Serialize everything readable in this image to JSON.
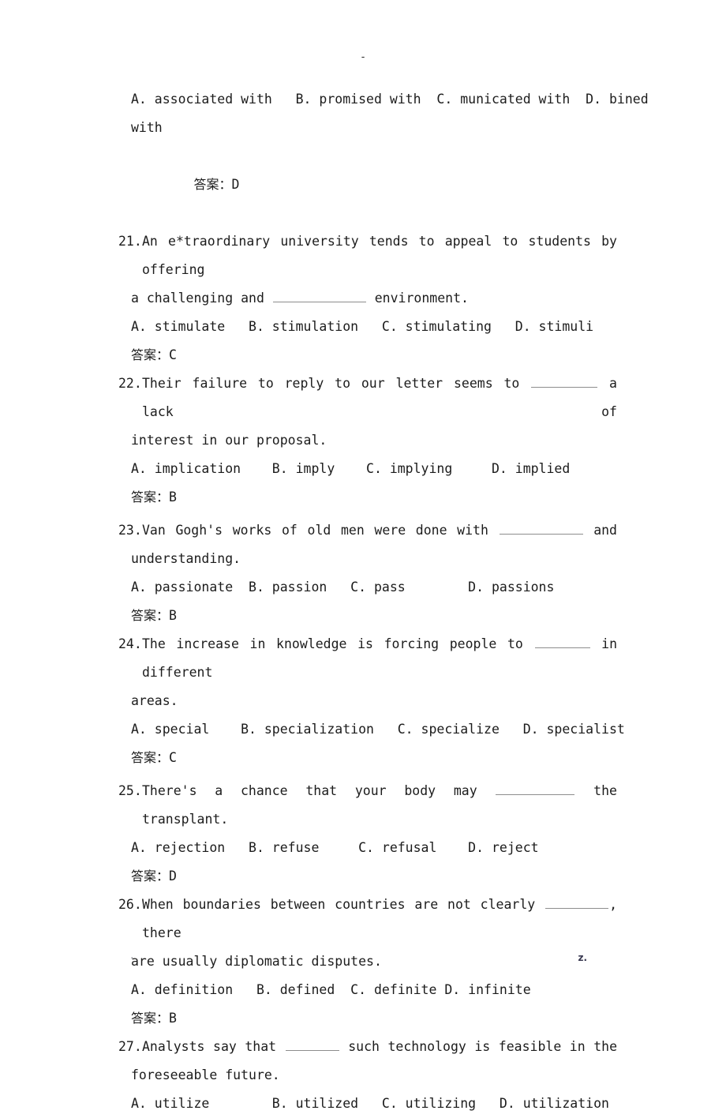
{
  "page": {
    "header_mark": "-",
    "footer_left_mark": "·",
    "footer_right_mark": "z."
  },
  "answer_label": "答案：",
  "partial_question": {
    "options_line": "A. associated with   B. promised with  C. municated with  D. bined",
    "options_wrap": "with",
    "answer": "D"
  },
  "questions": [
    {
      "number": "21.",
      "stem_lines": [
        {
          "pre": "An e*traordinary university tends to appeal to students by offering",
          "blank": 0,
          "post": ""
        },
        {
          "pre": "a challenging and ",
          "blank": 118,
          "post": " environment."
        }
      ],
      "options": "A. stimulate   B. stimulation   C. stimulating   D. stimuli",
      "answer": "C"
    },
    {
      "number": "22.",
      "stem_lines": [
        {
          "pre": "Their failure to reply to our letter seems to ",
          "blank": 84,
          "post": " a lack of"
        },
        {
          "pre": "interest in our proposal.",
          "blank": 0,
          "post": ""
        }
      ],
      "options": "A. implication    B. imply    C. implying     D. implied",
      "answer": "B"
    },
    {
      "number": "23.",
      "stem_lines": [
        {
          "pre": "Van Gogh's works of old men were done with ",
          "blank": 106,
          "post": " and"
        },
        {
          "pre": "understanding.",
          "blank": 0,
          "post": ""
        }
      ],
      "options": "A. passionate  B. passion   C. pass        D. passions",
      "answer": "B"
    },
    {
      "number": "24.",
      "stem_lines": [
        {
          "pre": "The increase in knowledge is forcing people to ",
          "blank": 70,
          "post": " in different"
        },
        {
          "pre": "areas.",
          "blank": 0,
          "post": ""
        }
      ],
      "options": "A. special    B. specialization   C. specialize   D. specialist",
      "answer": "C"
    },
    {
      "number": "25.",
      "stem_lines": [
        {
          "pre": "There's a chance that your body may ",
          "blank": 100,
          "post": " the transplant."
        }
      ],
      "options": "A. rejection   B. refuse     C. refusal    D. reject",
      "answer": "D"
    },
    {
      "number": "26.",
      "stem_lines": [
        {
          "pre": "When boundaries between countries are not clearly ",
          "blank": 80,
          "post": ", there"
        },
        {
          "pre": "are usually diplomatic disputes.",
          "blank": 0,
          "post": ""
        }
      ],
      "options": "A. definition   B. defined  C. definite D. infinite",
      "answer": "B"
    },
    {
      "number": "27.",
      "stem_lines": [
        {
          "pre": "Analysts say that ",
          "blank": 68,
          "post": " such technology is feasible in the"
        },
        {
          "pre": "foreseeable future.",
          "blank": 0,
          "post": ""
        }
      ],
      "options": "A. utilize        B. utilized   C. utilizing   D. utilization",
      "answer": ""
    }
  ]
}
